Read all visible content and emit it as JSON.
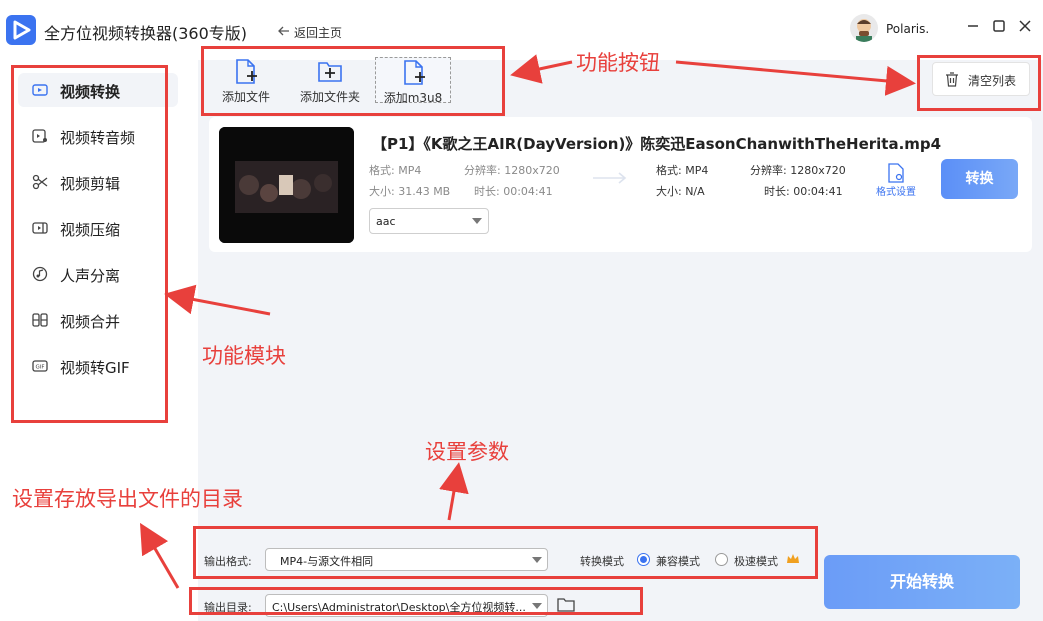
{
  "app": {
    "title": "全方位视频转换器(360专版)",
    "back_home_label": "返回主页",
    "user_name": "Polaris."
  },
  "sidebar": {
    "items": [
      {
        "label": "视频转换",
        "icon": "video-convert-icon",
        "active": true
      },
      {
        "label": "视频转音频",
        "icon": "video-to-audio-icon",
        "active": false
      },
      {
        "label": "视频剪辑",
        "icon": "scissors-icon",
        "active": false
      },
      {
        "label": "视频压缩",
        "icon": "compress-icon",
        "active": false
      },
      {
        "label": "人声分离",
        "icon": "voice-separate-icon",
        "active": false
      },
      {
        "label": "视频合并",
        "icon": "merge-icon",
        "active": false
      },
      {
        "label": "视频转GIF",
        "icon": "gif-icon",
        "active": false
      }
    ]
  },
  "toolbar": {
    "add_file": "添加文件",
    "add_folder": "添加文件夹",
    "add_m3u8": "添加m3u8",
    "clear_list": "清空列表"
  },
  "file": {
    "name": "【P1】《K歌之王AIR(DayVersion)》陈奕迅EasonChanwithTheHerita.mp4",
    "source": {
      "format": "格式: MP4",
      "resolution": "分辨率: 1280x720",
      "size": "大小: 31.43 MB",
      "duration": "时长: 00:04:41"
    },
    "output": {
      "format": "格式: MP4",
      "resolution": "分辨率: 1280x720",
      "size": "大小: N/A",
      "duration": "时长: 00:04:41"
    },
    "audio_codec": "aac",
    "format_settings_label": "格式设置",
    "convert_label": "转换"
  },
  "bottom": {
    "output_format_label": "输出格式:",
    "output_format_value": "MP4-与源文件相同",
    "convert_mode_label": "转换模式",
    "mode_compatible": "兼容模式",
    "mode_fast": "极速模式",
    "output_dir_label": "输出目录:",
    "output_dir_value": "C:\\Users\\Administrator\\Desktop\\全方位视频转...",
    "start_label": "开始转换"
  },
  "annotations": {
    "function_buttons": "功能按钮",
    "function_modules": "功能模块",
    "set_params": "设置参数",
    "set_output_dir": "设置存放导出文件的目录"
  },
  "colors": {
    "accent": "#3b73f0",
    "annotation": "#e8403c"
  }
}
